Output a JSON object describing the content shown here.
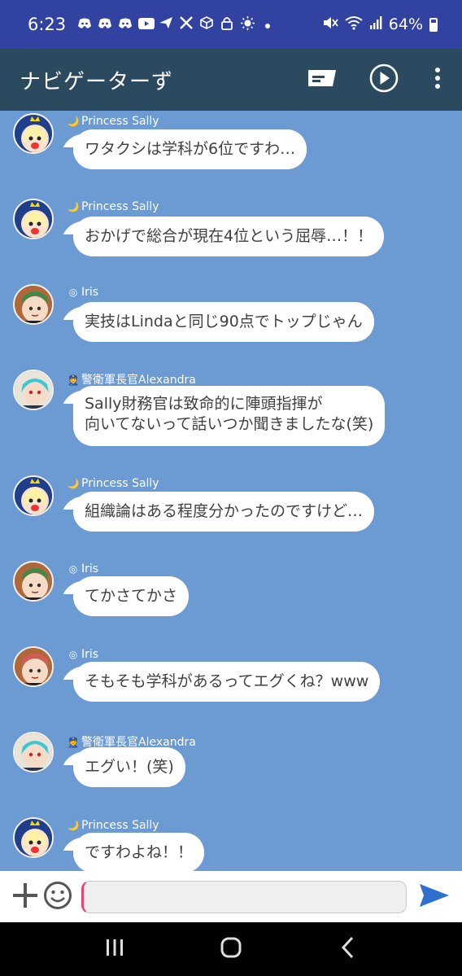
{
  "status_bar": {
    "time": "6:23",
    "battery": "64%",
    "icons": [
      "discord-icon",
      "discord-icon",
      "discord-icon",
      "youtube-icon",
      "share-icon",
      "x-icon",
      "box-icon",
      "lock-icon",
      "sun-icon",
      "dot-icon"
    ],
    "right_icons": [
      "mute-icon",
      "wifi-icon",
      "signal-icon",
      "battery-icon"
    ]
  },
  "header": {
    "title": "ナビゲーターず",
    "actions": [
      "flag-icon",
      "play-icon",
      "more-icon"
    ]
  },
  "colors": {
    "status_bar": "#3142a0",
    "header": "#2c4a5f",
    "chat_background": "#6c9ad3",
    "bubble": "#ffffff",
    "accent": "#2f6fd0"
  },
  "messages": [
    {
      "sender": "Princess Sally",
      "badge": "🌙",
      "avatar": "princess-sally",
      "lines": [
        "ワタクシは学科が6位ですわ…"
      ]
    },
    {
      "sender": "Princess Sally",
      "badge": "🌙",
      "avatar": "princess-sally",
      "lines": [
        "おかげで総合が現在4位という屈辱…！！"
      ]
    },
    {
      "sender": "Iris",
      "badge": "◎",
      "avatar": "iris",
      "lines": [
        "実技はLindaと同じ90点でトップじゃん"
      ]
    },
    {
      "sender": "警衛軍長官Alexandra",
      "badge": "👮",
      "avatar": "alexandra",
      "lines": [
        "Sally財務官は致命的に陣頭指揮が",
        "向いてないって話いつか聞きましたな(笑)"
      ]
    },
    {
      "sender": "Princess Sally",
      "badge": "🌙",
      "avatar": "princess-sally",
      "lines": [
        "組織論はある程度分かったのですけど…"
      ]
    },
    {
      "sender": "Iris",
      "badge": "◎",
      "avatar": "iris",
      "lines": [
        "てかさてかさ"
      ]
    },
    {
      "sender": "Iris",
      "badge": "◎",
      "avatar": "iris",
      "lines": [
        "そもそも学科があるってエグくね？www"
      ]
    },
    {
      "sender": "警衛軍長官Alexandra",
      "badge": "👮",
      "avatar": "alexandra",
      "lines": [
        "エグい！(笑)"
      ]
    },
    {
      "sender": "Princess Sally",
      "badge": "🌙",
      "avatar": "princess-sally",
      "lines": [
        "ですわよね！！"
      ]
    }
  ],
  "input": {
    "value": "",
    "placeholder": ""
  },
  "nav": [
    "recent-apps-icon",
    "home-icon",
    "back-icon"
  ]
}
